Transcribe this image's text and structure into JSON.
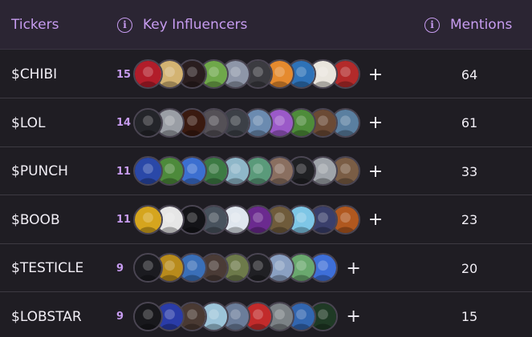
{
  "header": {
    "tickers_label": "Tickers",
    "influencers_label": "Key Influencers",
    "mentions_label": "Mentions",
    "info_glyph": "i"
  },
  "rows": [
    {
      "ticker": "$CHIBI",
      "count": "15",
      "mentions": "64",
      "avatars": [
        "#b21d2a",
        "#d3b372",
        "#2a1e1f",
        "#6fa84a",
        "#8e96a8",
        "#3b3b40",
        "#e58a2e",
        "#2e72b8",
        "#e9e5dd",
        "#b32a2a"
      ]
    },
    {
      "ticker": "$LOL",
      "count": "14",
      "mentions": "61",
      "avatars": [
        "#24252a",
        "#9a9ea5",
        "#3a1a10",
        "#545056",
        "#3c4047",
        "#6b8bb0",
        "#9b59c8",
        "#4e8c3a",
        "#6b4a35",
        "#5a7fa0"
      ]
    },
    {
      "ticker": "$PUNCH",
      "count": "11",
      "mentions": "33",
      "avatars": [
        "#2a48a8",
        "#4d8a3b",
        "#3c6fd0",
        "#3d7a44",
        "#8fb7c9",
        "#5a9a7a",
        "#8a6f60",
        "#202124",
        "#9fa4aa",
        "#7a5d45"
      ]
    },
    {
      "ticker": "$BOOB",
      "count": "11",
      "mentions": "23",
      "avatars": [
        "#d5a51e",
        "#e6e6e6",
        "#141418",
        "#48525d",
        "#dfe6ee",
        "#6b2a8f",
        "#6f5b3b",
        "#7ec6e6",
        "#3a3f6b",
        "#b0581f"
      ]
    },
    {
      "ticker": "$TESTICLE",
      "count": "9",
      "mentions": "20",
      "avatars": [
        "#1b1b20",
        "#b88b1c",
        "#3a6fb8",
        "#4a3b36",
        "#6d7a4a",
        "#202024",
        "#8aa0c2",
        "#6aa86e",
        "#3e6fd8"
      ]
    },
    {
      "ticker": "$LOBSTAR",
      "count": "9",
      "mentions": "15",
      "avatars": [
        "#18181c",
        "#2a3ca8",
        "#4a3a33",
        "#9cc4d9",
        "#6b7d9a",
        "#c22b2b",
        "#7c8286",
        "#3266b0",
        "#1f3a25"
      ]
    }
  ],
  "plus_glyph": "+",
  "colors": {
    "background": "#1f1d23",
    "header_background": "#2b2533",
    "accent": "#c79cf0",
    "text": "#f1eef5",
    "divider": "#3d3a42"
  }
}
